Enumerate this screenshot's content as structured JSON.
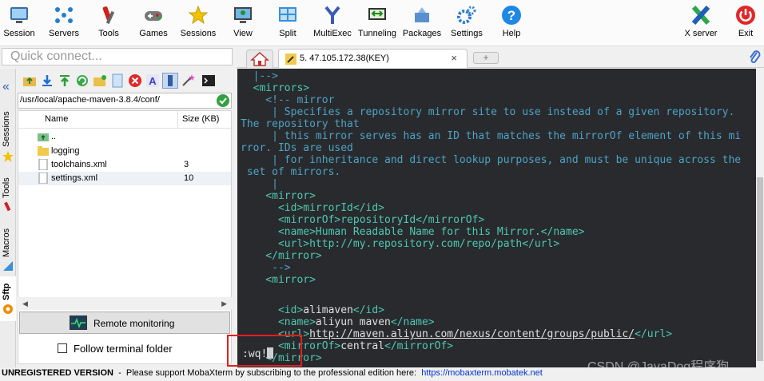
{
  "toolbar": {
    "items": [
      {
        "label": "Session",
        "icon": "session-icon"
      },
      {
        "label": "Servers",
        "icon": "servers-icon"
      },
      {
        "label": "Tools",
        "icon": "tools-icon"
      },
      {
        "label": "Games",
        "icon": "games-icon"
      },
      {
        "label": "Sessions",
        "icon": "sessions-star-icon"
      },
      {
        "label": "View",
        "icon": "view-icon"
      },
      {
        "label": "Split",
        "icon": "split-icon"
      },
      {
        "label": "MultiExec",
        "icon": "multiexec-icon"
      },
      {
        "label": "Tunneling",
        "icon": "tunneling-icon"
      },
      {
        "label": "Packages",
        "icon": "packages-icon"
      },
      {
        "label": "Settings",
        "icon": "settings-icon"
      },
      {
        "label": "Help",
        "icon": "help-icon"
      }
    ],
    "xserver_label": "X server",
    "exit_label": "Exit"
  },
  "quick_connect": {
    "placeholder": "Quick connect..."
  },
  "side_tabs": [
    {
      "label": "Sessions"
    },
    {
      "label": "Tools"
    },
    {
      "label": "Macros"
    },
    {
      "label": "Sftp"
    }
  ],
  "sftp": {
    "path": "/usr/local/apache-maven-3.8.4/conf/",
    "columns": {
      "name": "Name",
      "size": "Size (KB)"
    },
    "files": [
      {
        "name": "..",
        "size": "",
        "type": "parent"
      },
      {
        "name": "logging",
        "size": "",
        "type": "folder"
      },
      {
        "name": "toolchains.xml",
        "size": "3",
        "type": "file"
      },
      {
        "name": "settings.xml",
        "size": "10",
        "type": "file"
      }
    ],
    "remote_monitoring": "Remote monitoring",
    "follow_terminal": "Follow terminal folder"
  },
  "tabs": {
    "active_title": "5. 47.105.172.38(KEY)",
    "close": "×",
    "new_tab": "+"
  },
  "terminal": {
    "lines": [
      {
        "text": "  |-->",
        "cls": "c-comment"
      },
      {
        "text": "  <mirrors>",
        "cls": "c-tag"
      },
      {
        "text": "    <!-- mirror",
        "cls": "c-comment"
      },
      {
        "text": "     | Specifies a repository mirror site to use instead of a given repository.",
        "cls": "c-comment"
      },
      {
        "text": "The repository that",
        "cls": "c-comment"
      },
      {
        "text": "     | this mirror serves has an ID that matches the mirrorOf element of this mi",
        "cls": "c-comment"
      },
      {
        "text": "rror. IDs are used",
        "cls": "c-comment"
      },
      {
        "text": "     | for inheritance and direct lookup purposes, and must be unique across the",
        "cls": "c-comment"
      },
      {
        "text": " set of mirrors.",
        "cls": "c-comment"
      },
      {
        "text": "     |",
        "cls": "c-comment"
      },
      {
        "text": "    <mirror>",
        "cls": "c-tag"
      },
      {
        "text": "      <id>mirrorId</id>",
        "cls": "c-tag"
      },
      {
        "text": "      <mirrorOf>repositoryId</mirrorOf>",
        "cls": "c-tag"
      },
      {
        "text": "      <name>Human Readable Name for this Mirror.</name>",
        "cls": "c-tag"
      },
      {
        "text": "      <url>http://my.repository.com/repo/path</url>",
        "cls": "c-tag"
      },
      {
        "text": "    </mirror>",
        "cls": "c-tag"
      },
      {
        "text": "     -->",
        "cls": "c-comment"
      },
      {
        "text": "    <mirror>",
        "cls": "c-tag"
      }
    ],
    "ali_id_open": "      <id>",
    "ali_id_val": "alimaven",
    "ali_id_close": "</id>",
    "ali_name_open": "      <name>",
    "ali_name_val": "aliyun maven",
    "ali_name_close": "</name>",
    "ali_url_open": "      <url>",
    "ali_url_val": "http://maven.aliyun.com/nexus/content/groups/public/",
    "ali_url_close": "</url>",
    "ali_of_open": "      <mirrorOf>",
    "ali_of_val": "central",
    "ali_of_close": "</mirrorOf>",
    "mirror_close": "    </mirror>",
    "command": ":wq!"
  },
  "watermark": "CSDN @JavaDog程序狗",
  "status": {
    "unregistered": "UNREGISTERED VERSION",
    "message": "  -  Please support MobaXterm by subscribing to the professional edition here:  ",
    "link": "https://mobaxterm.mobatek.net"
  }
}
